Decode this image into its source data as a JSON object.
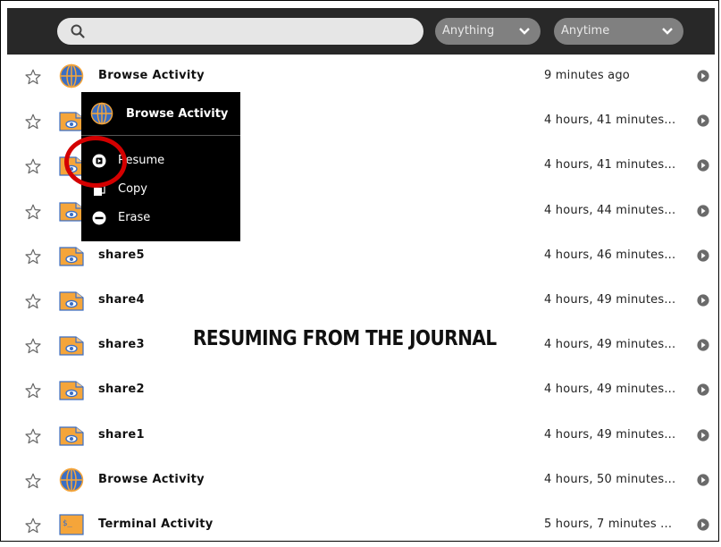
{
  "toolbar": {
    "search": {
      "value": "",
      "placeholder": ""
    },
    "filter_type": {
      "label": "Anything"
    },
    "filter_time": {
      "label": "Anytime"
    }
  },
  "entries": [
    {
      "title": "Browse Activity",
      "icon": "globe-icon",
      "time": "9 minutes ago"
    },
    {
      "title": "",
      "icon": "shared-file-icon",
      "time": "4 hours, 41 minutes..."
    },
    {
      "title": "",
      "icon": "shared-file-icon",
      "time": "4 hours, 41 minutes..."
    },
    {
      "title": "",
      "icon": "shared-file-icon",
      "time": "4 hours, 44 minutes..."
    },
    {
      "title": "share5",
      "icon": "shared-file-icon",
      "time": "4 hours, 46 minutes..."
    },
    {
      "title": "share4",
      "icon": "shared-file-icon",
      "time": "4 hours, 49 minutes..."
    },
    {
      "title": "share3",
      "icon": "shared-file-icon",
      "time": "4 hours, 49 minutes..."
    },
    {
      "title": "share2",
      "icon": "shared-file-icon",
      "time": "4 hours, 49 minutes..."
    },
    {
      "title": "share1",
      "icon": "shared-file-icon",
      "time": "4 hours, 49 minutes..."
    },
    {
      "title": "Browse Activity",
      "icon": "globe-icon",
      "time": "4 hours, 50 minutes..."
    },
    {
      "title": "Terminal Activity",
      "icon": "terminal-icon",
      "time": "5 hours, 7 minutes ..."
    }
  ],
  "context_menu": {
    "title": "Browse Activity",
    "items": [
      {
        "label": "Resume",
        "icon": "resume-icon"
      },
      {
        "label": "Copy",
        "icon": "copy-icon"
      },
      {
        "label": "Erase",
        "icon": "erase-icon"
      }
    ]
  },
  "overlay_caption": "RESUMING FROM THE JOURNAL",
  "colors": {
    "toolbar_bg": "#282828",
    "search_bg": "#e6e6e6",
    "dropdown_bg": "#808080",
    "file_icon_orange": "#f5a53a",
    "file_icon_blue": "#3a6ec4",
    "highlight_red": "#d40000",
    "menu_bg": "#000000"
  }
}
